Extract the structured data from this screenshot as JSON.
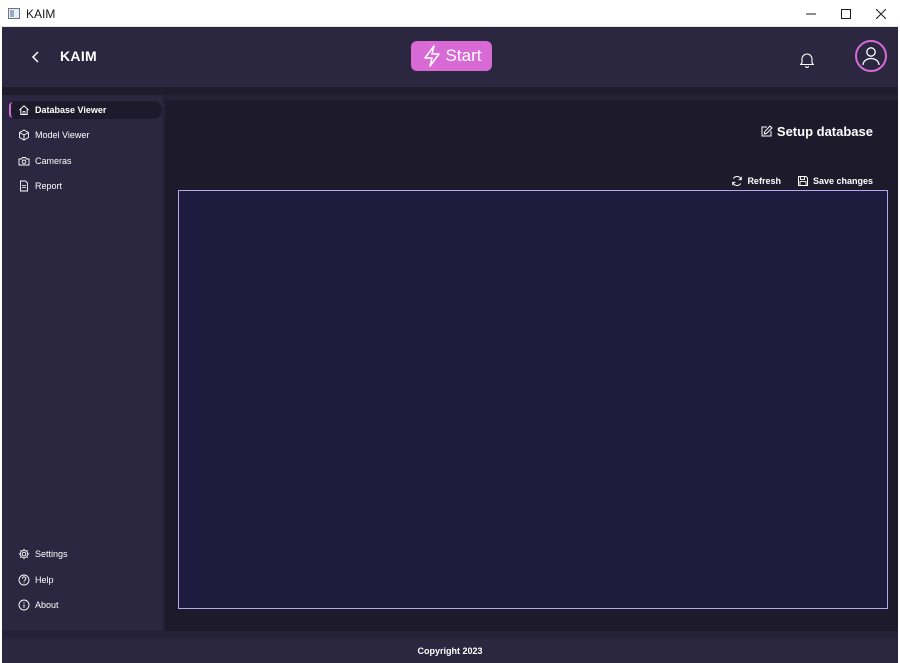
{
  "window": {
    "title": "KAIM",
    "icon": "app-window-icon",
    "controls": [
      "minimize-icon",
      "maximize-icon",
      "close-icon"
    ]
  },
  "header": {
    "brand": "KAIM",
    "start_label": "Start",
    "icons": [
      "back-chevron-icon",
      "lightning-icon",
      "bell-icon",
      "user-icon"
    ]
  },
  "sidebar": {
    "items": [
      {
        "label": "Database Viewer",
        "icon": "home-icon",
        "active": true
      },
      {
        "label": "Model Viewer",
        "icon": "cube-icon"
      },
      {
        "label": "Cameras",
        "icon": "camera-icon"
      },
      {
        "label": "Report",
        "icon": "document-icon"
      }
    ],
    "bottom_items": [
      {
        "label": "Settings",
        "icon": "gear-icon"
      },
      {
        "label": "Help",
        "icon": "help-icon"
      },
      {
        "label": "About",
        "icon": "info-icon"
      }
    ]
  },
  "main": {
    "setup_label": "Setup database",
    "refresh_label": "Refresh",
    "save_label": "Save changes"
  },
  "footer": {
    "copyright": "Copyright 2023"
  },
  "colors": {
    "accent": "#d86ad6",
    "panel_border": "#b7a7ec",
    "background": "#252237",
    "panel": "#1d1c3e"
  }
}
